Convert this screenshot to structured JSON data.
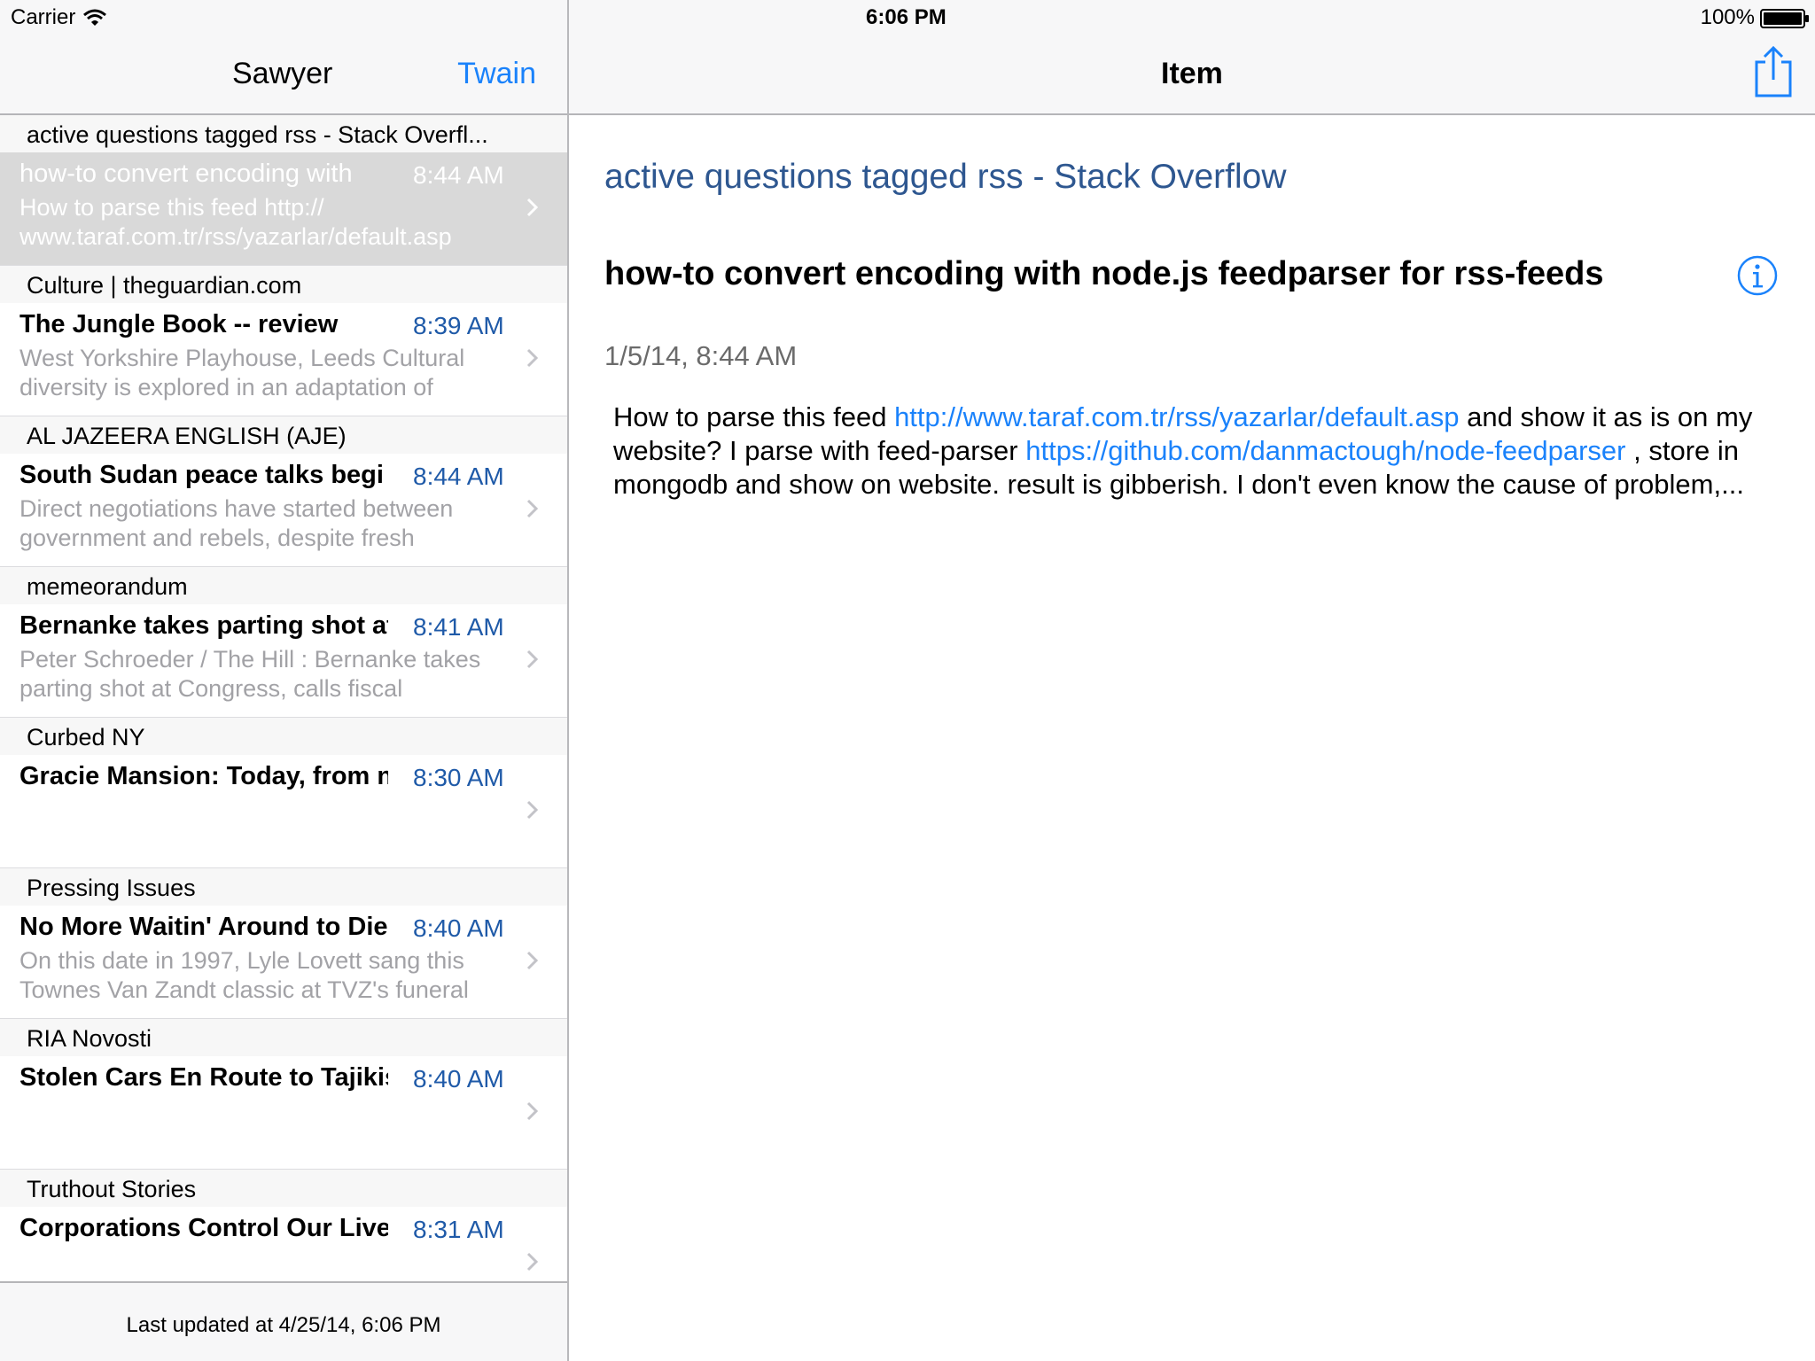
{
  "status_bar": {
    "carrier": "Carrier",
    "time": "6:06 PM",
    "battery": "100%"
  },
  "master": {
    "title": "Sawyer",
    "right_button": "Twain",
    "footer": "Last updated at 4/25/14, 6:06 PM",
    "sections": [
      {
        "header": "active questions tagged rss - Stack Overfl...",
        "item": {
          "title": "how-to convert encoding with",
          "time": "8:44 AM",
          "summary": "How to parse this feed http:// www.taraf.com.tr/rss/yazarlar/default.asp",
          "selected": true
        }
      },
      {
        "header": "Culture | theguardian.com",
        "item": {
          "title": "The Jungle Book -- review",
          "time": "8:39 AM",
          "summary": "West Yorkshire Playhouse, Leeds Cultural diversity is explored in an adaptation of",
          "selected": false
        }
      },
      {
        "header": "AL JAZEERA ENGLISH (AJE)",
        "item": {
          "title": "South Sudan peace talks begi",
          "time": "8:44 AM",
          "summary": "Direct negotiations have started between government and rebels, despite fresh",
          "selected": false
        }
      },
      {
        "header": "memeorandum",
        "item": {
          "title": "Bernanke takes parting shot at",
          "time": "8:41 AM",
          "summary": "Peter Schroeder / The Hill : Bernanke takes parting shot at Congress, calls fiscal",
          "selected": false
        }
      },
      {
        "header": "Curbed NY",
        "item": {
          "title": "Gracie Mansion: Today, from n",
          "time": "8:30 AM",
          "summary": "",
          "selected": false
        }
      },
      {
        "header": "Pressing Issues",
        "item": {
          "title": "No More Waitin' Around to Die",
          "time": "8:40 AM",
          "summary": "On this date in 1997, Lyle Lovett sang this Townes Van Zandt classic at TVZ's funeral",
          "selected": false
        }
      },
      {
        "header": "RIA Novosti",
        "item": {
          "title": "Stolen Cars En Route to Tajikis",
          "time": "8:40 AM",
          "summary": "",
          "selected": false
        }
      },
      {
        "header": "Truthout Stories",
        "item": {
          "title": "Corporations Control Our Lives",
          "time": "8:31 AM",
          "summary": "",
          "selected": false
        }
      }
    ]
  },
  "detail": {
    "nav_title": "Item",
    "feed_title": "active questions tagged rss - Stack Overflow",
    "item_title": "how-to convert encoding with node.js feedparser for rss-feeds",
    "date": "1/5/14, 8:44 AM",
    "body": {
      "p1": "How to parse this feed ",
      "link1": "http://www.taraf.com.tr/rss/yazarlar/default.asp",
      "p2": " and show it as is on my website? I parse with feed-parser ",
      "link2": "https://github.com/danmactough/node-feedparser",
      "p3": " , store in mongodb and show on website. result is gibberish. I don't even know the cause of problem,..."
    }
  },
  "colors": {
    "accent": "#1a82fb",
    "time_blue": "#1f5aa8",
    "feed_title": "#2e5790",
    "selected_row": "#d9d9d9"
  },
  "icons": [
    "wifi-icon",
    "battery-icon",
    "share-icon",
    "info-icon",
    "chevron-right-icon"
  ]
}
